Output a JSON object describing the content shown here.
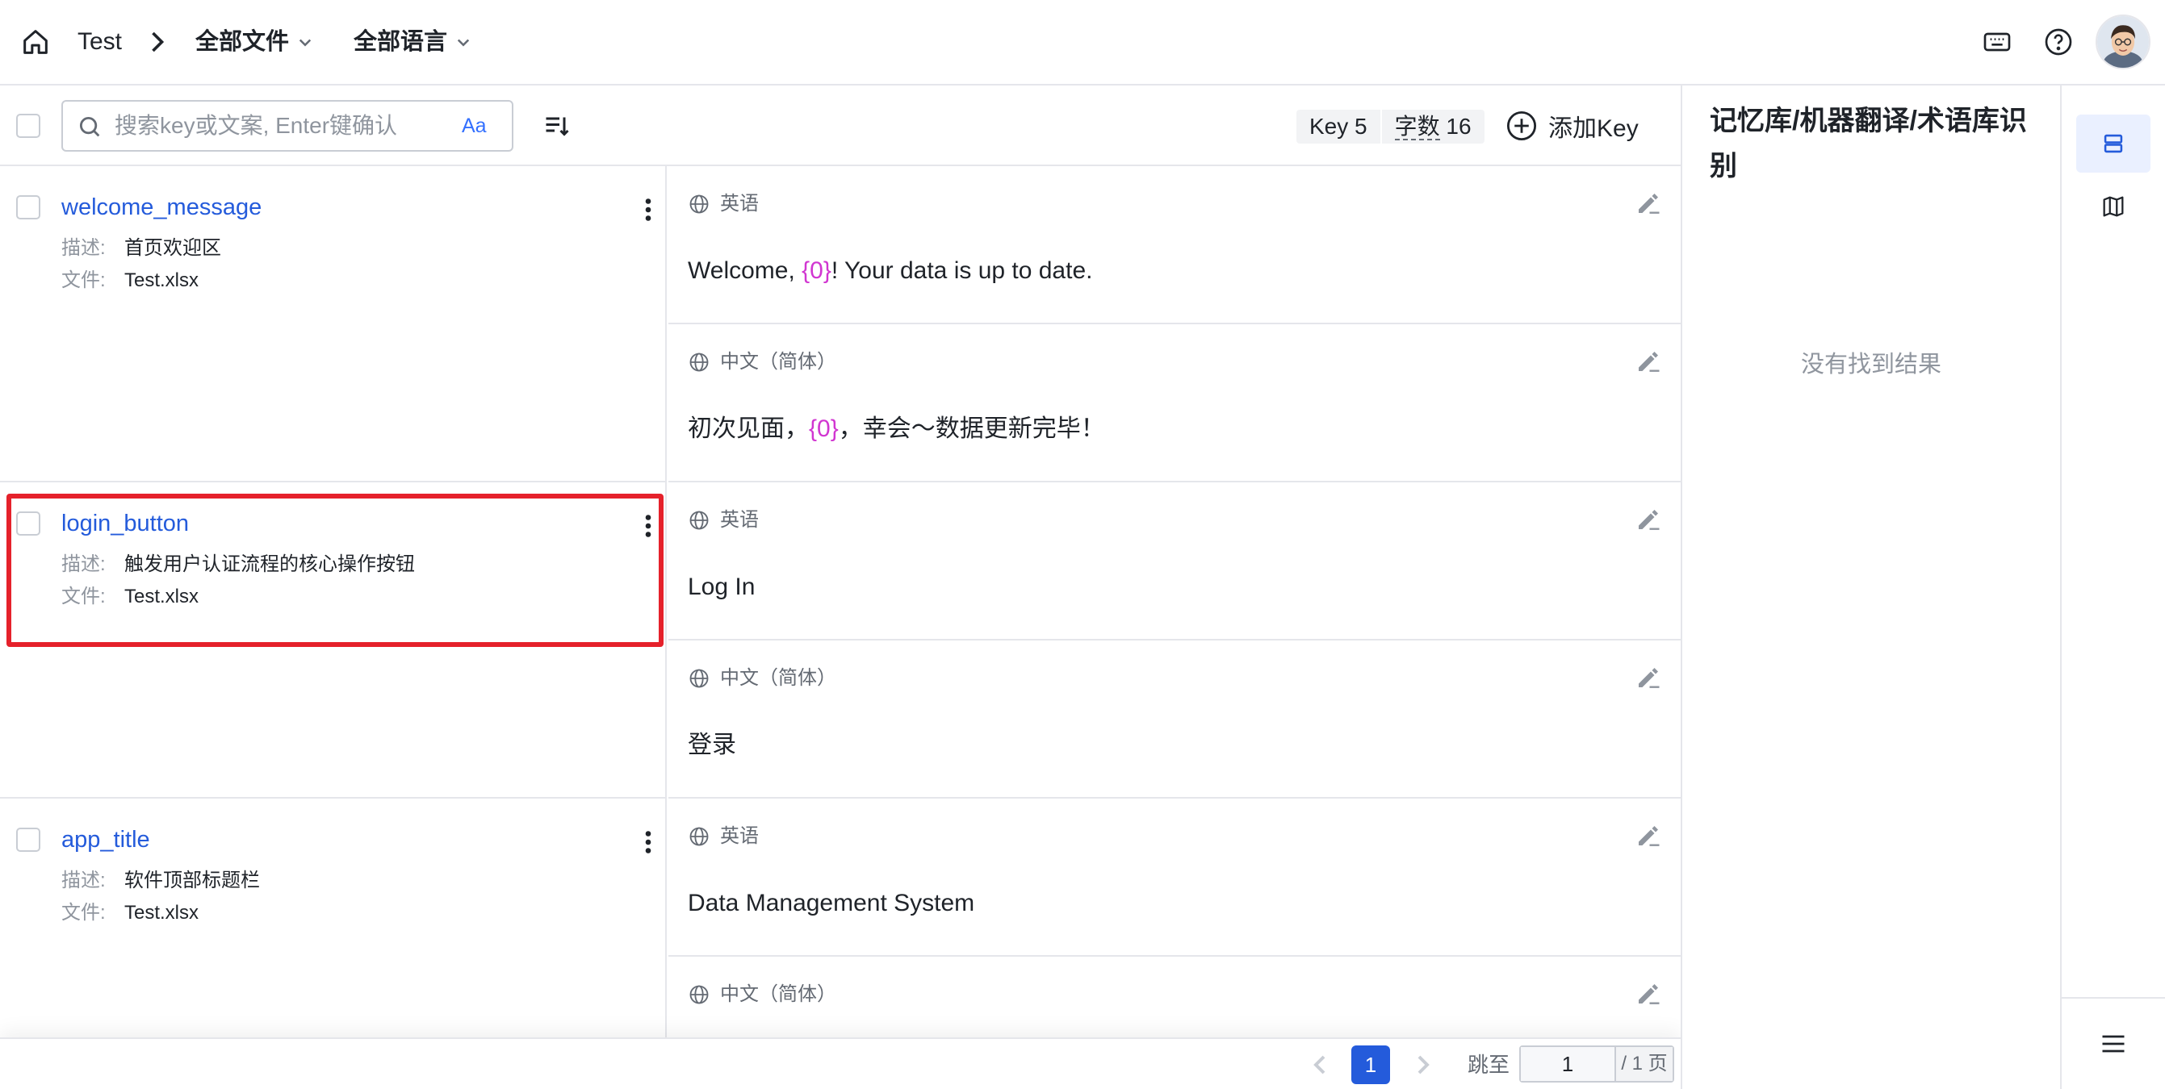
{
  "header": {
    "home_icon": "home-icon",
    "project": "Test",
    "breadcrumb_sep_icon": "chevron-right-icon",
    "file_filter": "全部文件",
    "lang_filter": "全部语言",
    "keyboard_icon": "keyboard-icon",
    "help_icon": "help-icon",
    "avatar_icon": "user-avatar"
  },
  "toolbar": {
    "search_placeholder": "搜索key或文案, Enter键确认",
    "case_toggle": "Aa",
    "sort_icon": "sort-icon",
    "key_count": "Key 5",
    "word_label": "字数",
    "word_count": "16",
    "add_key": "添加Key"
  },
  "labels": {
    "desc": "描述:",
    "file": "文件:"
  },
  "keys": [
    {
      "name": "welcome_message",
      "desc": "首页欢迎区",
      "file": "Test.xlsx",
      "translations": [
        {
          "lang": "英语",
          "pre": "Welcome, ",
          "ph": "{0}",
          "post": "! Your data is up to date."
        },
        {
          "lang": "中文（简体）",
          "pre": "初次见面，",
          "ph": "{0}",
          "post": "，幸会～数据更新完毕！"
        }
      ]
    },
    {
      "name": "login_button",
      "desc": "触发用户认证流程的核心操作按钮",
      "file": "Test.xlsx",
      "translations": [
        {
          "lang": "英语",
          "pre": "Log In",
          "ph": "",
          "post": ""
        },
        {
          "lang": "中文（简体）",
          "pre": "登录",
          "ph": "",
          "post": ""
        }
      ]
    },
    {
      "name": "app_title",
      "desc": "软件顶部标题栏",
      "file": "Test.xlsx",
      "translations": [
        {
          "lang": "英语",
          "pre": "Data Management System",
          "ph": "",
          "post": ""
        },
        {
          "lang": "中文（简体）",
          "pre": "",
          "ph": "",
          "post": ""
        }
      ]
    }
  ],
  "pagination": {
    "current": "1",
    "jump_label": "跳至",
    "jump_value": "1",
    "total": "/ 1 页"
  },
  "right_panel": {
    "title": "记忆库/机器翻译/术语库识别",
    "empty": "没有找到结果"
  },
  "right_sidebar": {
    "items": [
      "list-view-icon",
      "map-icon"
    ],
    "menu_icon": "menu-icon"
  },
  "colors": {
    "accent": "#245bdb",
    "placeholder_token": "#d136d1",
    "highlight_border": "#e5212b"
  }
}
